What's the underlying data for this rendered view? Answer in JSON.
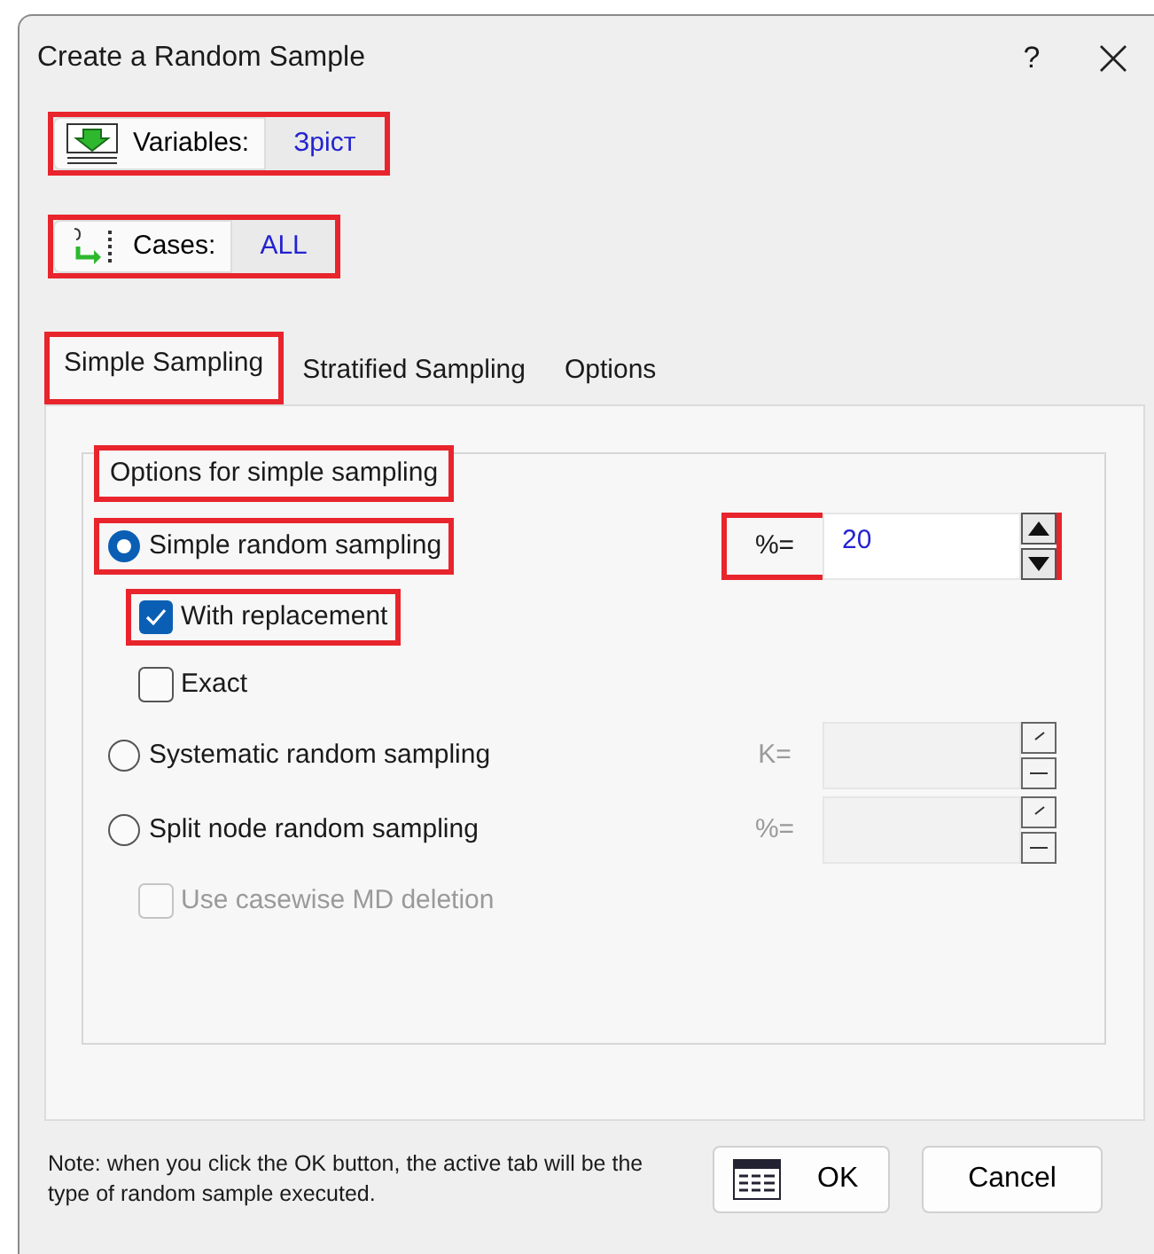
{
  "window": {
    "title": "Create a Random Sample",
    "help": "?"
  },
  "selectors": [
    {
      "kind": "variables",
      "label": "Variables:",
      "value": "Зріст",
      "highlighted": true
    },
    {
      "kind": "cases",
      "label": "Cases:",
      "value": "ALL",
      "highlighted": true
    }
  ],
  "tabs": [
    {
      "label": "Simple Sampling",
      "selected": true,
      "highlighted": true
    },
    {
      "label": "Stratified Sampling",
      "selected": false,
      "highlighted": false
    },
    {
      "label": "Options",
      "selected": false,
      "highlighted": false
    }
  ],
  "group": {
    "title": "Options for simple sampling",
    "highlighted": true,
    "options": [
      {
        "kind": "radio",
        "label": "Simple random sampling",
        "selected": true,
        "highlighted": true,
        "field": {
          "label": "%=",
          "value": "20",
          "disabled": false,
          "highlighted": true
        }
      },
      {
        "kind": "checkbox",
        "label": "With replacement",
        "checked": true,
        "disabled": false,
        "highlighted": true
      },
      {
        "kind": "checkbox",
        "label": "Exact",
        "checked": false,
        "disabled": false,
        "highlighted": false
      },
      {
        "kind": "radio",
        "label": "Systematic random sampling",
        "selected": false,
        "highlighted": false,
        "field": {
          "label": "K=",
          "disabled": true,
          "highlighted": false
        }
      },
      {
        "kind": "radio",
        "label": "Split node random sampling",
        "selected": false,
        "highlighted": false,
        "field": {
          "label": "%=",
          "disabled": true,
          "highlighted": false
        }
      },
      {
        "kind": "checkbox",
        "label": "Use casewise MD deletion",
        "checked": false,
        "disabled": true,
        "highlighted": false
      }
    ]
  },
  "note": "Note: when you click the OK button, the active tab will be the type of random sample executed.",
  "buttons": [
    {
      "kind": "ok",
      "label": "OK"
    },
    {
      "kind": "cancel",
      "label": "Cancel"
    }
  ]
}
